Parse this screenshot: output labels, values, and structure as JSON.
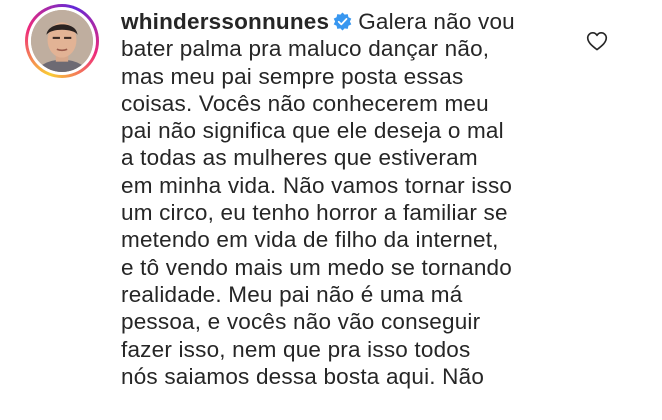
{
  "comment": {
    "username": "whinderssonnunes",
    "verified_icon": "verified-badge-icon",
    "like_icon": "heart-outline-icon",
    "accent_color": "#3897f0",
    "lines": [
      "Galera não vou",
      "bater palma pra maluco dançar não,",
      "mas meu pai sempre posta essas",
      "coisas. Vocês não conhecerem meu",
      "pai não significa que ele deseja o mal",
      "a todas as mulheres que estiveram",
      "em minha vida. Não vamos tornar isso",
      "um circo, eu tenho horror a familiar se",
      "metendo em vida de filho da internet,",
      "e tô vendo mais um medo se tornando",
      "realidade. Meu pai não é uma má",
      "pessoa, e vocês não vão conseguir",
      "fazer isso, nem que pra isso todos",
      "nós saiamos dessa bosta aqui. Não"
    ]
  }
}
